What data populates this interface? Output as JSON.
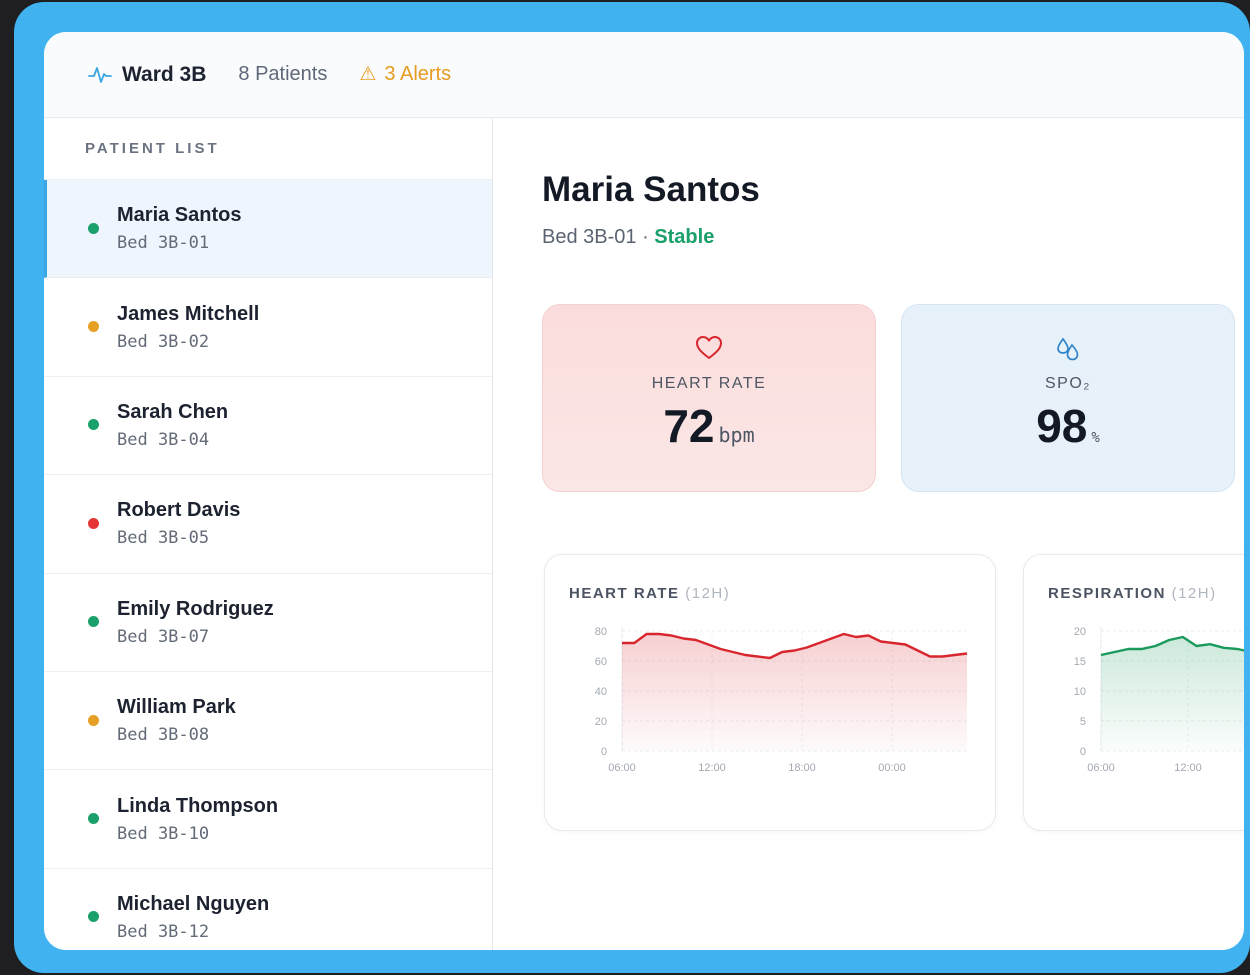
{
  "header": {
    "ward": "Ward 3B",
    "patients": "8 Patients",
    "alerts": "3 Alerts"
  },
  "sidebar": {
    "title": "PATIENT LIST",
    "patients": [
      {
        "name": "Maria Santos",
        "bed": "Bed 3B-01",
        "status_color": "#1aa06b"
      },
      {
        "name": "James Mitchell",
        "bed": "Bed 3B-02",
        "status_color": "#e6a026"
      },
      {
        "name": "Sarah Chen",
        "bed": "Bed 3B-04",
        "status_color": "#1aa06b"
      },
      {
        "name": "Robert Davis",
        "bed": "Bed 3B-05",
        "status_color": "#e53535"
      },
      {
        "name": "Emily Rodriguez",
        "bed": "Bed 3B-07",
        "status_color": "#1aa06b"
      },
      {
        "name": "William Park",
        "bed": "Bed 3B-08",
        "status_color": "#e6a026"
      },
      {
        "name": "Linda Thompson",
        "bed": "Bed 3B-10",
        "status_color": "#1aa06b"
      },
      {
        "name": "Michael Nguyen",
        "bed": "Bed 3B-12",
        "status_color": "#1aa06b"
      }
    ]
  },
  "detail": {
    "name": "Maria Santos",
    "bed": "Bed 3B-01 · ",
    "status": "Stable",
    "vitals": {
      "heart_rate": {
        "label": "HEART RATE",
        "value": "72",
        "unit": "bpm"
      },
      "spo2": {
        "label": "SPO₂",
        "value": "98",
        "unit": "%"
      }
    }
  },
  "colors": {
    "accent": "#3fb2ef",
    "stable": "#1aa06b",
    "warning": "#e69b22",
    "critical": "#e53535",
    "hr_line": "#d8262e",
    "resp_line": "#1a9a5c"
  },
  "chart_data": [
    {
      "type": "area",
      "title": "HEART RATE",
      "subtitle": "(12H)",
      "x_ticks": [
        "06:00",
        "12:00",
        "18:00",
        "00:00"
      ],
      "y_ticks": [
        0,
        20,
        40,
        60,
        80
      ],
      "ylim": [
        0,
        80
      ],
      "series": [
        {
          "values": [
            72,
            72,
            78,
            78,
            77,
            75,
            74,
            71,
            68,
            66,
            64,
            63,
            62,
            66,
            67,
            69,
            72,
            75,
            78,
            76,
            77,
            73,
            72,
            71,
            67,
            63,
            63,
            64,
            65
          ]
        }
      ]
    },
    {
      "type": "area",
      "title": "RESPIRATION",
      "subtitle": "(12H)",
      "x_ticks": [
        "06:00",
        "12:00"
      ],
      "y_ticks": [
        0,
        5,
        10,
        15,
        20
      ],
      "ylim": [
        0,
        20
      ],
      "series": [
        {
          "values": [
            16,
            16.5,
            17,
            17,
            17.5,
            18.5,
            19,
            17.5,
            17.8,
            17.2,
            17,
            16.5
          ]
        }
      ]
    }
  ]
}
